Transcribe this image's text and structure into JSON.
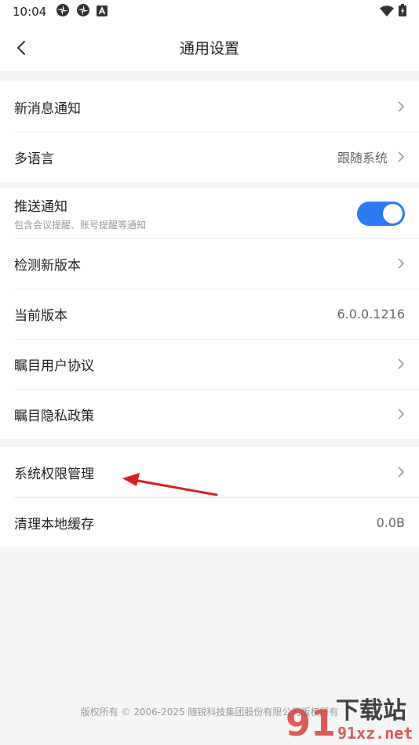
{
  "status_bar": {
    "time": "10:04"
  },
  "header": {
    "title": "通用设置",
    "back_icon": "chevron-left-icon"
  },
  "group1": {
    "items": [
      {
        "label": "新消息通知",
        "value": ""
      },
      {
        "label": "多语言",
        "value": "跟随系统"
      }
    ]
  },
  "group2": {
    "push": {
      "label": "推送通知",
      "sub": "包含会议提醒、账号提醒等通知",
      "enabled": true
    },
    "items": [
      {
        "label": "检测新版本",
        "value": ""
      },
      {
        "label": "当前版本",
        "value": "6.0.0.1216"
      },
      {
        "label": "瞩目用户协议",
        "value": ""
      },
      {
        "label": "瞩目隐私政策",
        "value": ""
      }
    ]
  },
  "group3": {
    "items": [
      {
        "label": "系统权限管理",
        "value": ""
      },
      {
        "label": "清理本地缓存",
        "value": "0.0B"
      }
    ]
  },
  "footer": {
    "copyright": "版权所有 © 2006-2025 随锐科技集团股份有限公司版权所有"
  },
  "watermark": {
    "text": "下载站",
    "url": "91xz.net"
  },
  "colors": {
    "accent": "#2b7cf2",
    "annotation_arrow": "#d62020"
  }
}
